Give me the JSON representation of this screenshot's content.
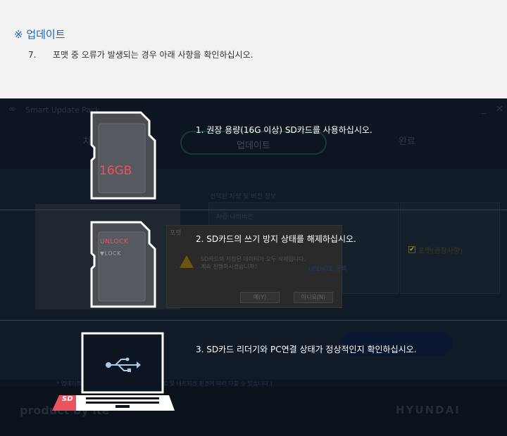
{
  "doc": {
    "title": "※ 업데이트",
    "step_number": "7.",
    "step_text": "포맷 중 오류가 발생되는 경우 아래 사항을 확인하십시오."
  },
  "app": {
    "name": "Smart Update Pack",
    "logo_icon": "∞",
    "minimize": "_",
    "close": "✕",
    "tabs": [
      "차",
      "업데이트",
      "완료"
    ],
    "info_header": "선택된 차량 및 버전 정보",
    "info_row": "차종     내비버전",
    "checkbox_label": "포맷(권장사항)",
    "checkbox_mark": "✔",
    "dialog": {
      "title": "포맷",
      "message_line1": "SD카드의 저장된 데이터가 모두 삭제됩니다.",
      "message_line2": "계속 진행하시겠습니까?",
      "yes": "예(Y)",
      "no": "아니요(N)"
    },
    "link_text": "UPDATE 등록",
    "note": "* 업데이트 시 평균 10~30분 소요됩니다. (PC 및 네트워크 환경에 따라 다를 수 있습니다.)",
    "product_by": "product by ite",
    "brand": "HYUNDAI"
  },
  "instructions": [
    "1. 권장 용량(16G 이상) SD카드를 사용하십시오.",
    "2. SD카드의 쓰기 방지 상태를 해제하십시오.",
    "3. SD카드 리더기와 PC연결 상태가 정상적인지 확인하십시오."
  ],
  "sd_card_1": {
    "label": "16GB"
  },
  "sd_card_2": {
    "unlock": "UNLOCK",
    "lock": "▼LOCK"
  },
  "laptop": {
    "usb_icon": "usb-icon",
    "sd_tag": "SD"
  },
  "colors": {
    "accent_red": "#e8545f",
    "title_blue": "#1f63b8",
    "overlay_bg": "#0d1520"
  }
}
